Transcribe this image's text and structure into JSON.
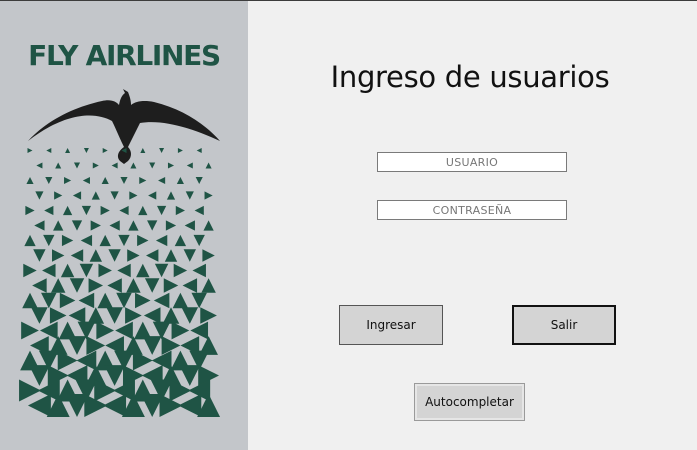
{
  "brand": {
    "name": "FLY AIRLINES",
    "color": "#1f5445"
  },
  "logo": {
    "icon": "eagle-icon",
    "pattern": "triangle-mosaic"
  },
  "form": {
    "title": "Ingreso de usuarios",
    "username_placeholder": "USUARIO",
    "password_placeholder": "CONTRASEÑA"
  },
  "buttons": {
    "login_label": "Ingresar",
    "exit_label": "Salir",
    "autocomplete_label": "Autocompletar"
  },
  "colors": {
    "panel": "#c3c6ca",
    "background": "#f0f0f0",
    "button": "#d4d4d4"
  }
}
